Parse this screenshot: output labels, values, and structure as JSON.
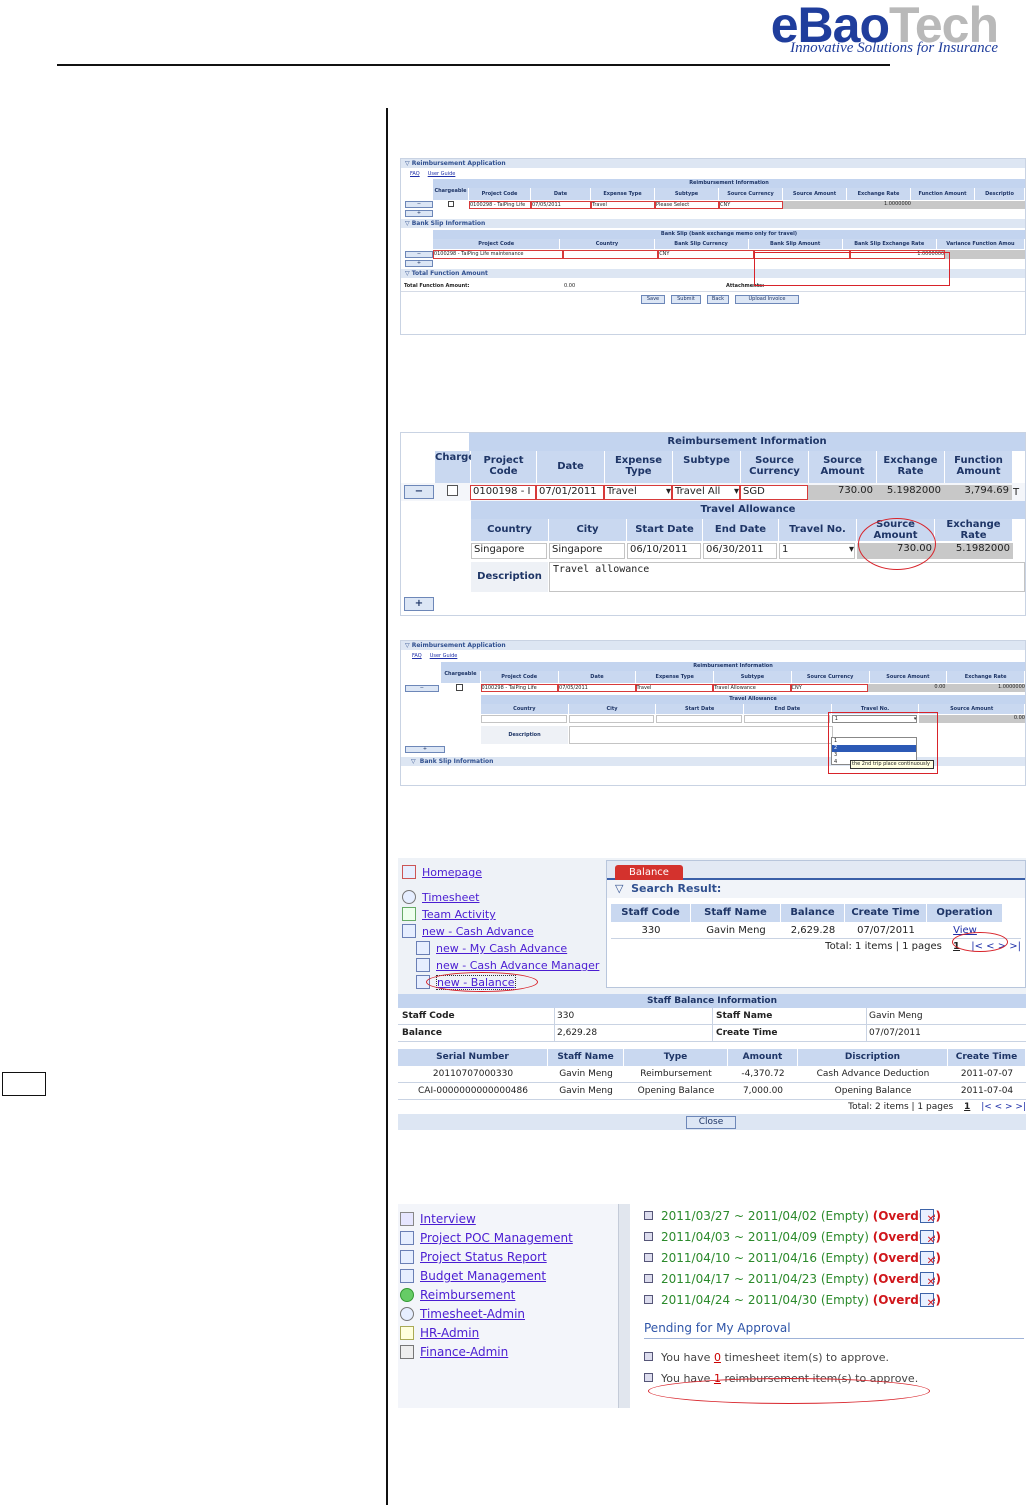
{
  "logo": {
    "part1": "eBao",
    "part2": "Tech",
    "tagline": "Innovative Solutions for Insurance"
  },
  "shot1": {
    "section_app": "Reimbursement Application",
    "links": [
      "FAQ",
      "User Guide"
    ],
    "band": "Reimbursement Information",
    "headers": [
      "Chargeable",
      "Project Code",
      "Date",
      "Expense Type",
      "Subtype",
      "Source Currency",
      "Source Amount",
      "Exchange Rate",
      "Function Amount",
      "Descriptio"
    ],
    "row": {
      "project": "0100298 - TaiPing Life",
      "date": "07/05/2011",
      "expense": "Travel",
      "subtype": "Please Select",
      "currency": "CNY",
      "rate": "1.0000000"
    },
    "section_bank": "Bank Slip Information",
    "bank_band": "Bank Slip (bank exchange memo only for travel)",
    "bank_headers": [
      "Project Code",
      "Country",
      "Bank Slip Currency",
      "Bank Slip Amount",
      "Bank Slip Exchange Rate",
      "Variance Function Amou"
    ],
    "bank_row": {
      "project": "0100298 - TaiPing Life maintenance",
      "currency": "CNY",
      "rate": "1.0000000"
    },
    "section_total": "Total Function Amount",
    "total_label": "Total Function Amount:",
    "total_value": "0.00",
    "attachments_label": "Attachments:",
    "buttons": [
      "Save",
      "Submit",
      "Back",
      "Upload Invoice"
    ]
  },
  "shot2": {
    "band": "Reimbursement Information",
    "headers": [
      "Chargeable",
      "Project Code",
      "Date",
      "Expense Type",
      "Subtype",
      "Source Currency",
      "Source Amount",
      "Exchange Rate",
      "Function Amount"
    ],
    "row": {
      "project": "0100198 - I",
      "date": "07/01/2011",
      "expense": "Travel",
      "subtype": "Travel All",
      "currency": "SGD",
      "source_amount": "730.00",
      "rate": "5.1982000",
      "function_amount": "3,794.69",
      "desc_cut": "T"
    },
    "ta_band": "Travel Allowance",
    "ta_headers": [
      "Country",
      "City",
      "Start Date",
      "End Date",
      "Travel No.",
      "Source Amount",
      "Exchange Rate"
    ],
    "ta_row": {
      "country": "Singapore",
      "city": "Singapore",
      "start": "06/10/2011",
      "end": "06/30/2011",
      "travel_no": "1",
      "amount": "730.00",
      "rate": "5.1982000"
    },
    "desc_label": "Description",
    "desc_value": "Travel allowance",
    "minus": "−",
    "plus": "+"
  },
  "shot3": {
    "section_app": "Reimbursement Application",
    "links": [
      "FAQ",
      "User Guide"
    ],
    "band": "Reimbursement Information",
    "headers": [
      "Chargeable",
      "Project Code",
      "Date",
      "Expense Type",
      "Subtype",
      "Source Currency",
      "Source Amount",
      "Exchange Rate"
    ],
    "row": {
      "project": "0100298 - TaiPing Life",
      "date": "07/05/2011",
      "expense": "Travel",
      "subtype": "Travel Allowance",
      "currency": "CNY",
      "amount": "0.00",
      "rate": "1.0000000"
    },
    "ta_band": "Travel Allowance",
    "ta_headers": [
      "Country",
      "City",
      "Start Date",
      "End Date",
      "Travel No.",
      "Source Amount"
    ],
    "ta_amount": "0.00",
    "travel_no_selected": "1",
    "options": [
      "1",
      "2",
      "3",
      "4"
    ],
    "tooltip": "the 2nd trip place continuously",
    "desc_label": "Description",
    "section_bank": "Bank Slip Information"
  },
  "shot4": {
    "nav": [
      "Homepage",
      "Timesheet",
      "Team Activity",
      "new - Cash Advance",
      "new - My Cash Advance",
      "new - Cash Advance Manager",
      "new - Balance"
    ],
    "tab": "Balance",
    "search_result": "Search Result:",
    "headers": [
      "Staff Code",
      "Staff Name",
      "Balance",
      "Create Time",
      "Operation"
    ],
    "row": [
      "330",
      "Gavin Meng",
      "2,629.28",
      "07/07/2011",
      "View"
    ],
    "pager": {
      "total": "Total: 1 items | 1 pages",
      "page": "1",
      "nav": "|< < > >|"
    },
    "info_title": "Staff Balance Information",
    "info": {
      "staff_code_label": "Staff Code",
      "staff_code": "330",
      "staff_name_label": "Staff Name",
      "staff_name": "Gavin Meng",
      "balance_label": "Balance",
      "balance": "2,629.28",
      "create_time_label": "Create Time",
      "create_time": "07/07/2011"
    },
    "detail_headers": [
      "Serial Number",
      "Staff Name",
      "Type",
      "Amount",
      "Discription",
      "Create Time"
    ],
    "detail_rows": [
      [
        "20110707000330",
        "Gavin Meng",
        "Reimbursement",
        "-4,370.72",
        "Cash Advance Deduction",
        "2011-07-07"
      ],
      [
        "CAI-0000000000000486",
        "Gavin Meng",
        "Opening Balance",
        "7,000.00",
        "Opening Balance",
        "2011-07-04"
      ]
    ],
    "detail_pager": {
      "total": "Total: 2 items | 1 pages",
      "page": "1",
      "nav": "|< < > >|"
    },
    "close": "Close"
  },
  "shot5": {
    "nav": [
      "Interview",
      "Project POC Management",
      "Project Status Report",
      "Budget Management",
      "Reimbursement",
      "Timesheet-Admin",
      "HR-Admin",
      "Finance-Admin"
    ],
    "weeks": [
      "2011/03/27 ~ 2011/04/02 (Empty)",
      "2011/04/03 ~ 2011/04/09 (Empty)",
      "2011/04/10 ~ 2011/04/16 (Empty)",
      "2011/04/17 ~ 2011/04/23 (Empty)",
      "2011/04/24 ~ 2011/04/30 (Empty)"
    ],
    "overdue": "(Overdue)",
    "pending_title": "Pending for My Approval",
    "pending": [
      {
        "pre": "You have ",
        "count": "0",
        "post": " timesheet item(s) to approve."
      },
      {
        "pre": "You have ",
        "count": "1",
        "post": " reimbursement item(s) to approve."
      }
    ]
  }
}
